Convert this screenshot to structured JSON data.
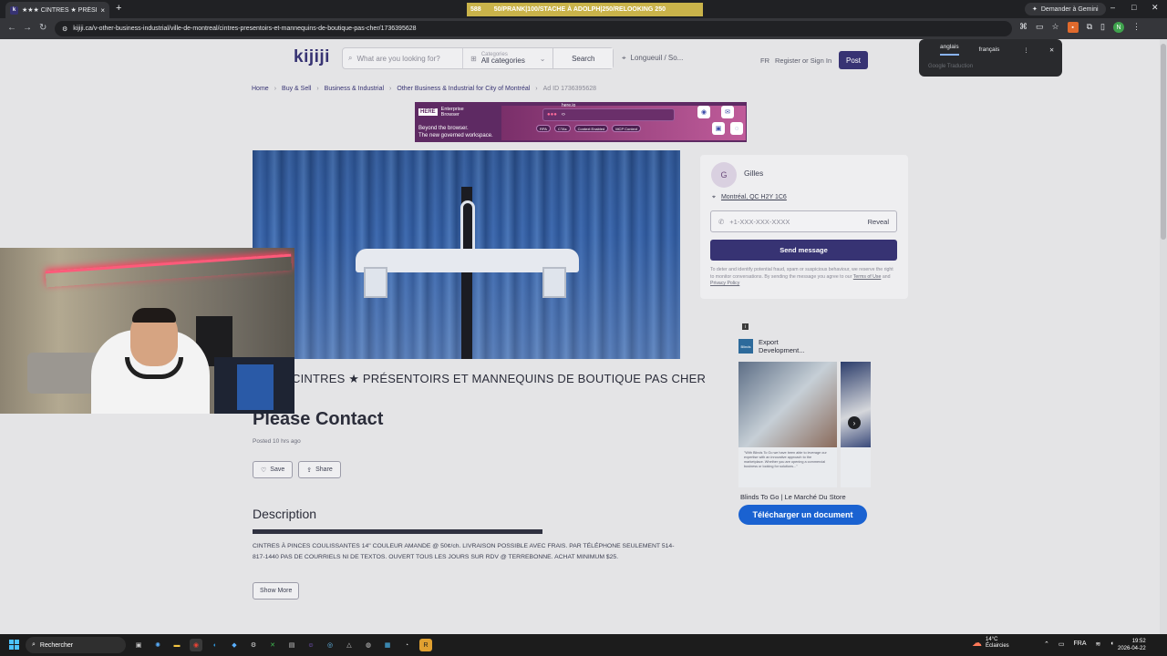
{
  "browser": {
    "tab_title": "★★★ CINTRES ★ PRÉSENTOIR",
    "tab_close": "×",
    "new_tab": "+",
    "ticker": [
      "588",
      "50/PRANK|100/STACHE À ADOLPH|250/RELOOKING 250"
    ],
    "gemini_label": "Demander à Gemini",
    "window_controls": [
      "–",
      "□",
      "✕"
    ],
    "url": "kijiji.ca/v-other-business-industrial/ville-de-montreal/cintres-presentoirs-et-mannequins-de-boutique-pas-cher/1736395628"
  },
  "translate_popup": {
    "tabs": [
      "anglais",
      "français"
    ],
    "footer": "Google Traduction"
  },
  "header": {
    "logo": "kijiji",
    "search_placeholder": "What are you looking for?",
    "category_label": "Categories",
    "category_value": "All categories",
    "search_button": "Search",
    "location": "Longueuil / So...",
    "lang_toggle": "FR",
    "register": "Register or Sign In",
    "post_button": "Post"
  },
  "breadcrumb": [
    "Home",
    "Buy & Sell",
    "Business & Industrial",
    "Other Business & Industrial for City of Montréal",
    "Ad ID 1736395628"
  ],
  "banner_ad": {
    "brand": "HERE",
    "brand_sub": "Enterprise Browser",
    "tagline_1": "Beyond the browser.",
    "tagline_2": "The new governed workspace.",
    "window_label": "here.io",
    "pills": [
      "RPA",
      "CTAs",
      "Context Enabled",
      "MCP Context"
    ]
  },
  "listing": {
    "title": "CINTRES ★ PRÉSENTOIRS ET MANNEQUINS DE BOUTIQUE PAS CHER",
    "price": "Please Contact",
    "posted": "Posted 10 hrs ago",
    "save": "Save",
    "share": "Share",
    "description_heading": "Description",
    "description": "CINTRES À PINCES COULISSANTES 14\" COULEUR AMANDE @ 50¢/ch. LIVRAISON POSSIBLE AVEC FRAIS. PAR TÉLÉPHONE SEULEMENT 514-817-1440 PAS DE COURRIELS NI DE TEXTOS. OUVERT TOUS LES JOURS SUR RDV @ TERREBONNE. ACHAT MINIMUM $25.",
    "show_more": "Show More"
  },
  "seller": {
    "initial": "G",
    "name": "Gilles",
    "location": "Montréal, QC H2Y 1C6",
    "phone": "+1-XXX-XXX-XXXX",
    "reveal": "Reveal",
    "send": "Send message",
    "disclaimer": "To deter and identify potential fraud, spam or suspicious behaviour, we reserve the right to monitor conversations. By sending the message you agree to our",
    "terms": "Terms of Use",
    "and": "and",
    "privacy": "Privacy Policy"
  },
  "side_ad": {
    "info": "i",
    "brand_logo": "Blinds",
    "brand_name_1": "Export",
    "brand_name_2": "Development...",
    "quote": "\"With Blinds To Go we have been able to leverage our expertise with an innovative approach to the marketplace. Whether you are opening a commercial business or looking for solutions...\"",
    "caption": "Blinds To Go | Le Marché Du Store",
    "download": "Télécharger un document"
  },
  "taskbar": {
    "search": "Rechercher",
    "temp": "14°C",
    "weather": "Éclaircies",
    "lang": "FRA",
    "time": "19:52",
    "date": "2026-04-22"
  }
}
